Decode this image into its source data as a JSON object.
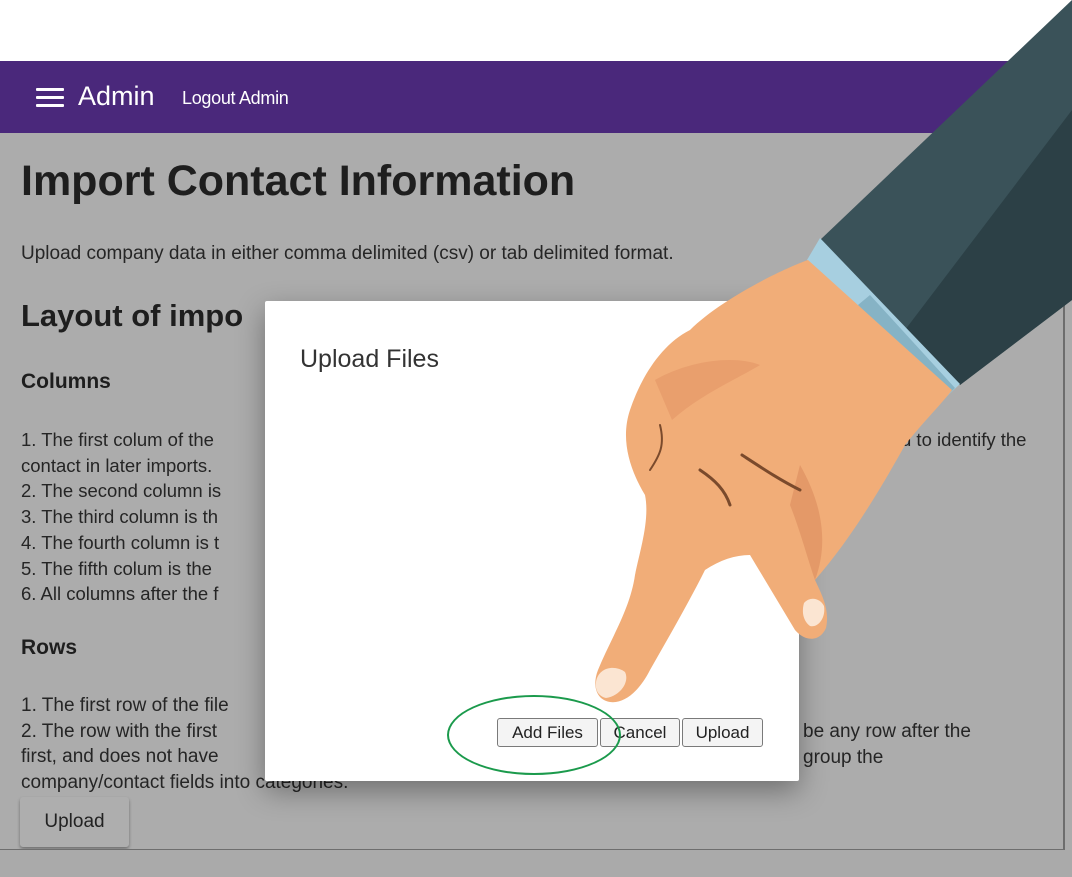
{
  "appbar": {
    "brand": "Admin",
    "logout_label": "Logout Admin",
    "color": "#4a287b"
  },
  "page": {
    "title": "Import Contact Information",
    "description": "Upload company data in either comma delimited (csv) or tab delimited format.",
    "layout_heading": "Layout of impo",
    "columns_heading": "Columns",
    "columns_lines": [
      "1. The first colum of the",
      "contact in later imports.",
      "2. The second column is",
      "3. The third column is th",
      "4. The fourth column is t",
      "5. The fifth colum is the",
      "6. All columns after the f"
    ],
    "columns_trailing": "d to identify the",
    "rows_heading": "Rows",
    "rows_lines": [
      "1. The first row of the file",
      "2. The row with the first",
      "first, and does not have",
      "company/contact fields into categories."
    ],
    "rows_trailing": [
      "be any row after the",
      "group the"
    ],
    "upload_button": "Upload"
  },
  "dialog": {
    "title": "Upload Files",
    "add_files": "Add Files",
    "cancel": "Cancel",
    "upload": "Upload"
  },
  "annotation": {
    "highlight_color": "#1b9a4c",
    "pointer": "hand-pointer-icon"
  }
}
